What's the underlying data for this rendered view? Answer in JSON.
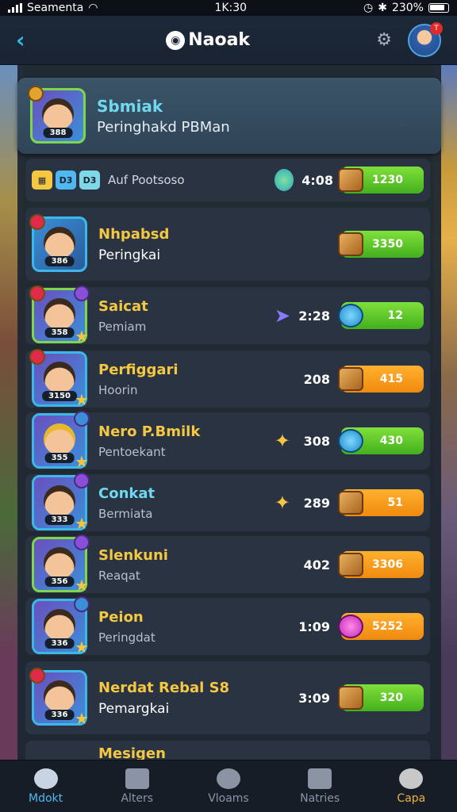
{
  "status_bar": {
    "carrier": "Seamenta",
    "time": "1K:30",
    "battery": "230%"
  },
  "header": {
    "brand": "Naoak",
    "back_icon": "chevron-left-icon",
    "settings_icon": "gear-icon",
    "notif_count": "T"
  },
  "featured": {
    "name": "Sbmiak",
    "subtitle": "Peringhakd PBMan",
    "level": "388"
  },
  "filter_row": {
    "chips": [
      "D3",
      "D3"
    ],
    "label": "Auf Pootsoso",
    "score": "4:08",
    "reward": "1230"
  },
  "rows": [
    {
      "name": "Nhpabsd",
      "subtitle": "Peringkai",
      "level": "386",
      "score": "",
      "reward": "3350",
      "pill": "green"
    },
    {
      "name": "Saicat",
      "subtitle": "Pemiam",
      "level": "358",
      "score": "2:28",
      "reward": "12",
      "pill": "green"
    },
    {
      "name": "Perfiggari",
      "subtitle": "Hoorin",
      "level": "3150",
      "score": "208",
      "reward": "415",
      "pill": "orange"
    },
    {
      "name": "Nero P.Bmilk",
      "subtitle": "Pentoekant",
      "level": "355",
      "score": "308",
      "reward": "430",
      "pill": "green"
    },
    {
      "name": "Conkat",
      "subtitle": "Bermiata",
      "level": "333",
      "score": "289",
      "reward": "51",
      "pill": "orange"
    },
    {
      "name": "Slenkuni",
      "subtitle": "Reaqat",
      "level": "356",
      "score": "402",
      "reward": "3306",
      "pill": "orange"
    },
    {
      "name": "Peion",
      "subtitle": "Peringdat",
      "level": "336",
      "score": "1:09",
      "reward": "5252",
      "pill": "orange"
    },
    {
      "name": "Nerdat Rebal S8",
      "subtitle": "Pemargkai",
      "level": "336",
      "score": "3:09",
      "reward": "320",
      "pill": "green"
    },
    {
      "name": "Mesigen",
      "subtitle": "",
      "level": "",
      "score": "",
      "reward": "",
      "pill": "orange"
    }
  ],
  "nav": [
    {
      "label": "Mdokt",
      "icon": "face-icon"
    },
    {
      "label": "Alters",
      "icon": "cards-icon"
    },
    {
      "label": "Vloams",
      "icon": "clock-icon"
    },
    {
      "label": "Natries",
      "icon": "people-icon"
    },
    {
      "label": "Capa",
      "icon": "chest-icon"
    }
  ],
  "colors": {
    "accent": "#38b6e8",
    "name_gold": "#f5c842",
    "reward_green": "#5fcc2a",
    "reward_orange": "#f9a020"
  }
}
